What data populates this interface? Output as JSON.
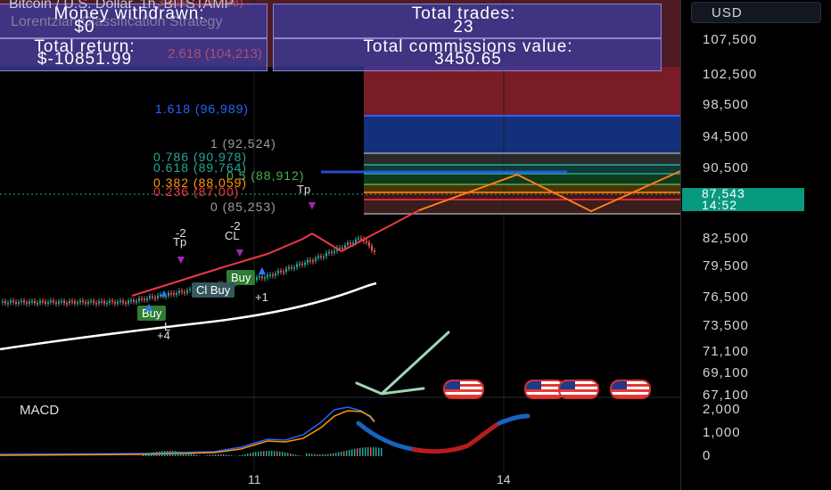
{
  "header": {
    "symbol_line": "Bitcoin / U.S. Dollar, 1h, BITSTAMP",
    "strategy_name": "Lorentzian Classification Strategy",
    "hidden_fib": "3.618 (111,438)",
    "hidden_fib2": "2.618 (104,213)"
  },
  "stats": {
    "money_label": "Money withdrawn:",
    "money_value": "$0",
    "trades_label": "Total trades:",
    "trades_value": "23",
    "return_label": "Total return:",
    "return_value": "$-10851.99",
    "commission_label": "Total commissions value:",
    "commission_value": "3450.65"
  },
  "fib_levels": [
    {
      "label": "1.618 (96,989)",
      "color": "#2962ff"
    },
    {
      "label": "1 (92,524)",
      "color": "#9e9e9e"
    },
    {
      "label": "0.786 (90,978)",
      "color": "#26a69a"
    },
    {
      "label": "0.618 (89,764)",
      "color": "#26a69a"
    },
    {
      "label": "0.5 (88,912)",
      "color": "#4caf50"
    },
    {
      "label": "0.382 (88,059)",
      "color": "#ff9800"
    },
    {
      "label": "0.236 (87,00)",
      "color": "#f23645"
    },
    {
      "label": "0 (85,253)",
      "color": "#9e9e9e"
    }
  ],
  "axis": {
    "currency": "USD",
    "prices": [
      "107,500",
      "102,500",
      "98,500",
      "94,500",
      "90,500",
      "82,500",
      "79,500",
      "76,500",
      "73,500",
      "71,100",
      "69,100",
      "67,100"
    ],
    "last_price": "87,543",
    "countdown": "14:52"
  },
  "macd": {
    "label": "MACD",
    "ticks": [
      "2,000",
      "1,000",
      "0"
    ]
  },
  "dates": [
    "11",
    "14"
  ],
  "signals": {
    "tp": "Tp",
    "minus2": "-2",
    "cl": "CL",
    "buy": "Buy",
    "cl_buy": "Cl Buy",
    "plus1": "+1",
    "plus4": "+4",
    "l": "L"
  },
  "colors": {
    "up": "#26a69a",
    "down": "#ef5350",
    "projection": "#f23645",
    "macd_line": "#2962ff",
    "signal_line": "#ff9800"
  }
}
